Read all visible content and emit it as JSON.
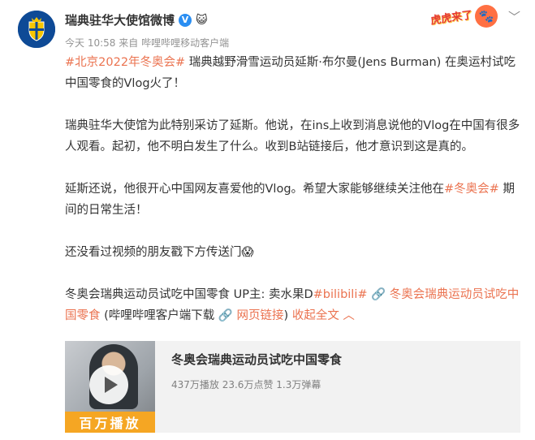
{
  "header": {
    "account_name": "瑞典驻华大使馆微博",
    "verified_badge": "V",
    "time": "今天 10:58",
    "source_prefix": "来自",
    "source": "哔哩哔哩移动客户端",
    "corner_brand": "虎虎来了",
    "more_icon": "chevron-down-icon"
  },
  "post": {
    "topic1": "#北京2022年冬奥会#",
    "line1": " 瑞典越野滑雪运动员延斯·布尔曼(Jens Burman) 在奥运村试吃中国零食的Vlog火了！",
    "para2": "瑞典驻华大使馆为此特别采访了延斯。他说，在ins上收到消息说他的Vlog在中国有很多人观看。起初，他不明白发生了什么。收到B站链接后，他才意识到这是真的。",
    "para3_pre": "延斯还说，他很开心中国网友喜爱他的Vlog。希望大家能够继续关注他在",
    "topic2": "#冬奥会#",
    "para3_post": " 期间的日常生活！",
    "para4": "还没看过视频的朋友戳下方传送门😱",
    "para5_pre": "冬奥会瑞典运动员试吃中国零食 UP主: 卖水果D",
    "topic3": "#bilibili#",
    "video_link_icon": "🔗",
    "video_link_text": " 冬奥会瑞典运动员试吃中国零食",
    "client_note": " (哔哩哔哩客户端下载 ",
    "web_link_icon": "🔗",
    "web_link_text": " 网页链接",
    "client_note_close": ")",
    "collapse_text": " 收起全文 ︿"
  },
  "card": {
    "tag": "百万播放",
    "title": "冬奥会瑞典运动员试吃中国零食",
    "stats": "437万播放 23.6万点赞 1.3万弹幕"
  }
}
